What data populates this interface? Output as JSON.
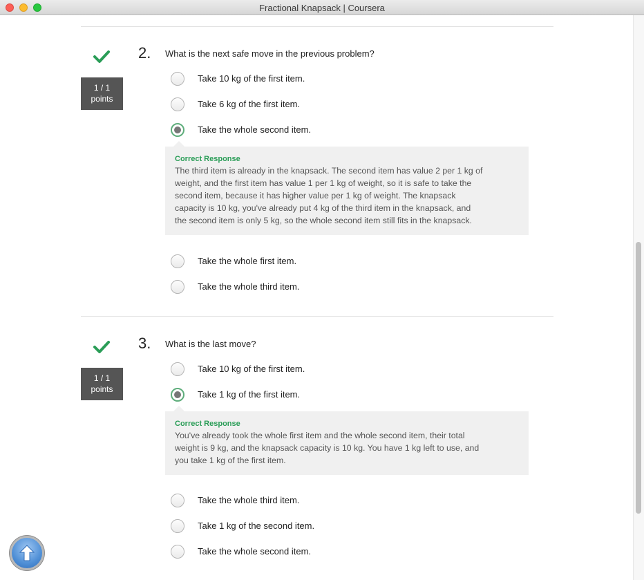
{
  "window": {
    "title": "Fractional Knapsack | Coursera"
  },
  "questions": [
    {
      "number": "2.",
      "text": "What is the next safe move in the previous problem?",
      "score": {
        "value": "1 / 1",
        "unit": "points"
      },
      "options": [
        {
          "label": "Take 10 kg of the first item.",
          "selected": false
        },
        {
          "label": "Take 6 kg of the first item.",
          "selected": false
        },
        {
          "label": "Take the whole second item.",
          "selected": true
        },
        {
          "label": "Take the whole first item.",
          "selected": false
        },
        {
          "label": "Take the whole third item.",
          "selected": false
        }
      ],
      "feedback": {
        "title": "Correct Response",
        "lines": [
          "The third item is already in the knapsack. The second item has value 2 per 1 kg of",
          "weight, and the first item has value 1 per 1 kg of weight, so it is safe to take the",
          "second item, because it has higher value per 1 kg of weight. The knapsack",
          "capacity is 10 kg, you've already put 4 kg of the third item in the knapsack, and",
          "the second item is only 5 kg, so the whole second item still fits in the knapsack."
        ]
      }
    },
    {
      "number": "3.",
      "text": "What is the last move?",
      "score": {
        "value": "1 / 1",
        "unit": "points"
      },
      "options": [
        {
          "label": "Take 10 kg of the first item.",
          "selected": false
        },
        {
          "label": "Take 1 kg of the first item.",
          "selected": true
        },
        {
          "label": "Take the whole third item.",
          "selected": false
        },
        {
          "label": "Take 1 kg of the second item.",
          "selected": false
        },
        {
          "label": "Take the whole second item.",
          "selected": false
        }
      ],
      "feedback": {
        "title": "Correct Response",
        "lines": [
          "You've already took the whole first item and the whole second item, their total",
          "weight is 9 kg, and the knapsack capacity is 10 kg. You have 1 kg left to use, and",
          "you take 1 kg of the first item."
        ]
      }
    }
  ],
  "colors": {
    "correct": "#2a9d57",
    "score_box": "#555555",
    "feedback_bg": "#f0f0f0"
  },
  "icons": {
    "check": "checkmark-icon",
    "scroll_top": "arrow-up-icon"
  }
}
